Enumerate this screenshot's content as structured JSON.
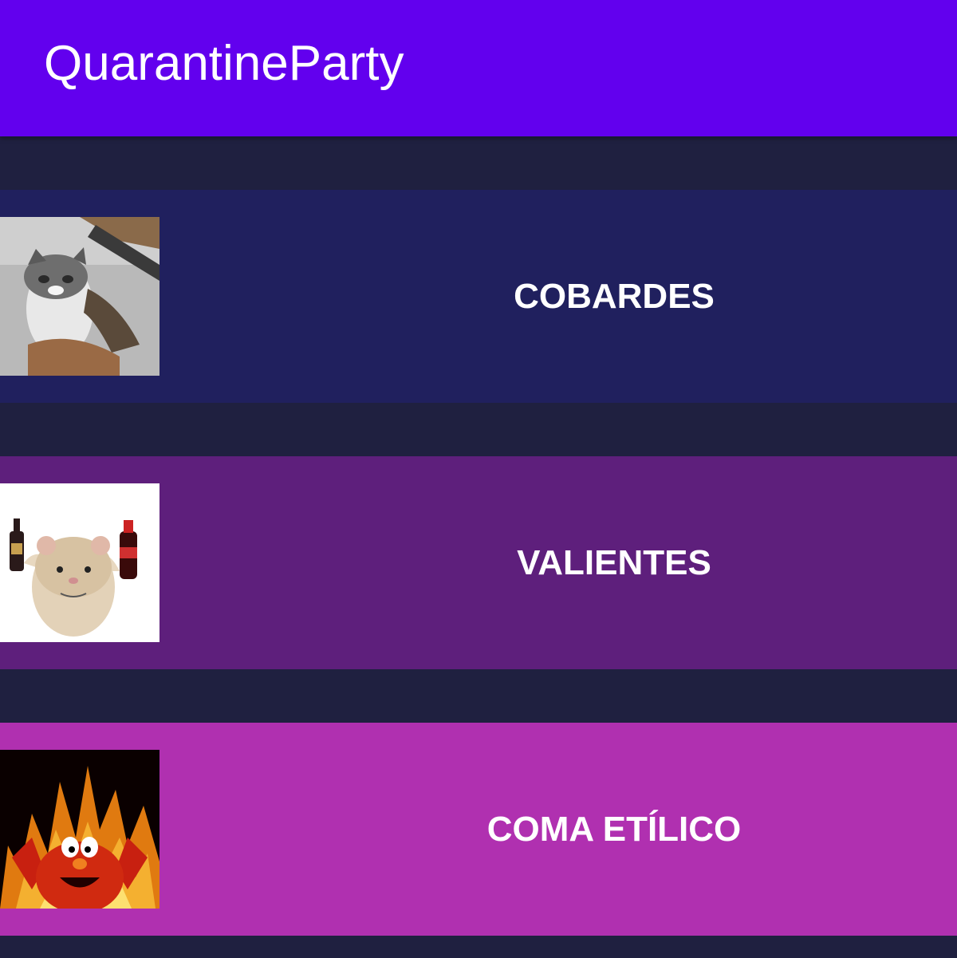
{
  "app_bar": {
    "title": "QuarantineParty",
    "color": "#6200ee"
  },
  "background_color": "#1f2040",
  "options": [
    {
      "label": "COBARDES",
      "color": "#20205e",
      "thumbnail": "scared-cat-image"
    },
    {
      "label": "VALIENTES",
      "color": "#5e1f7c",
      "thumbnail": "hamster-with-bottles-image"
    },
    {
      "label": "COMA ETÍLICO",
      "color": "#b030b0",
      "thumbnail": "elmo-on-fire-image"
    }
  ]
}
